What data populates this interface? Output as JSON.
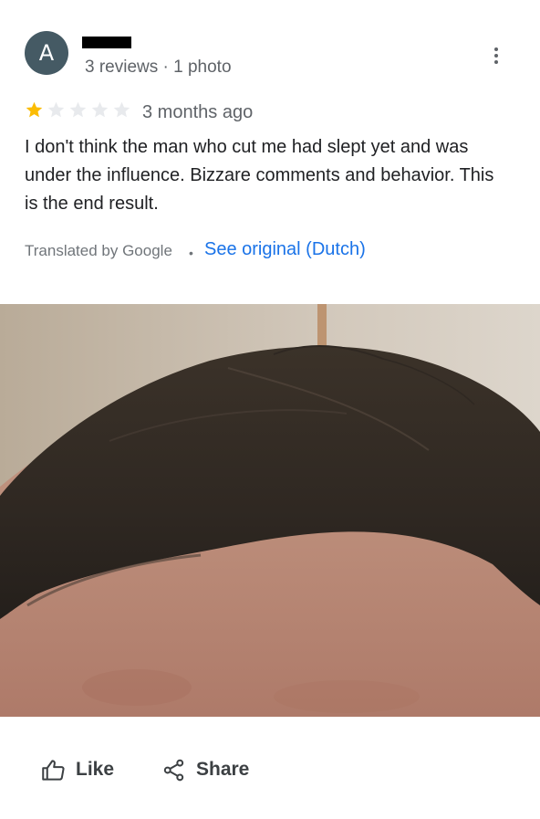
{
  "reviewer": {
    "avatar_letter": "A",
    "meta": "3 reviews · 1 photo"
  },
  "rating": {
    "value": 1,
    "max": 5,
    "filled_color": "#fbbc04",
    "empty_color": "#e8eaed",
    "time_ago": "3 months ago"
  },
  "review": {
    "text": "I don't think the man who cut me had slept yet and was under the influence. Bizzare comments and behavior. This is the end result."
  },
  "translation": {
    "label": "Translated by Google",
    "separator": "•",
    "see_original": "See original (Dutch)"
  },
  "photo": {
    "icon": "review-photo"
  },
  "actions": {
    "like_label": "Like",
    "share_label": "Share"
  },
  "colors": {
    "avatar_bg": "#455a64",
    "link": "#1a73e8",
    "secondary_text": "#5f6368"
  }
}
